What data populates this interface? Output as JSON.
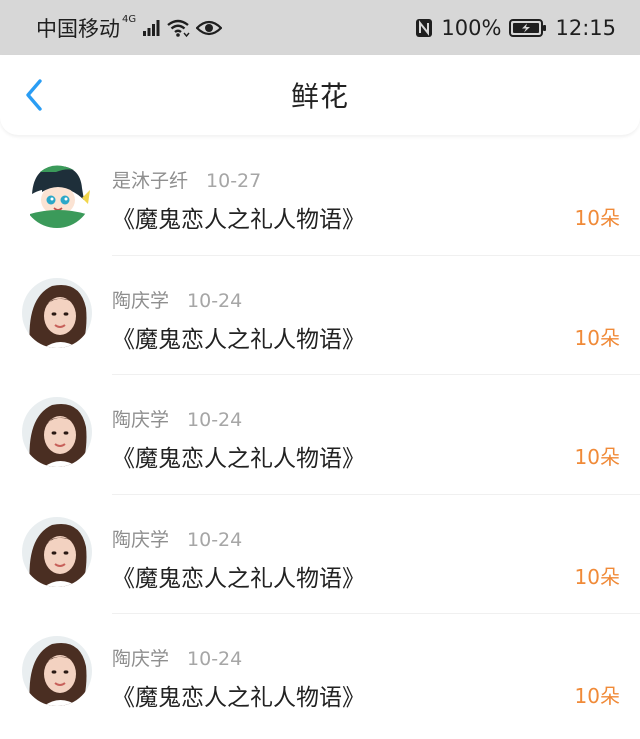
{
  "status_bar": {
    "carrier": "中国移动",
    "network": "4G",
    "battery": "100%",
    "time": "12:15",
    "icons": [
      "signal-icon",
      "wifi-icon",
      "eye-icon",
      "nfc-icon",
      "battery-charging-icon"
    ]
  },
  "header": {
    "title": "鲜花",
    "back_icon": "chevron-left-icon"
  },
  "colors": {
    "accent": "#2a9df4",
    "amount": "#f08a38",
    "status_bar_bg": "#d7d7d7"
  },
  "records": [
    {
      "user": "是沐子纤",
      "date": "10-27",
      "book": "《魔鬼恋人之礼人物语》",
      "amount": "10朵",
      "avatar": "anime-avatar"
    },
    {
      "user": "陶庆学",
      "date": "10-24",
      "book": "《魔鬼恋人之礼人物语》",
      "amount": "10朵",
      "avatar": "girl-photo-avatar"
    },
    {
      "user": "陶庆学",
      "date": "10-24",
      "book": "《魔鬼恋人之礼人物语》",
      "amount": "10朵",
      "avatar": "girl-photo-avatar"
    },
    {
      "user": "陶庆学",
      "date": "10-24",
      "book": "《魔鬼恋人之礼人物语》",
      "amount": "10朵",
      "avatar": "girl-photo-avatar"
    },
    {
      "user": "陶庆学",
      "date": "10-24",
      "book": "《魔鬼恋人之礼人物语》",
      "amount": "10朵",
      "avatar": "girl-photo-avatar"
    }
  ]
}
